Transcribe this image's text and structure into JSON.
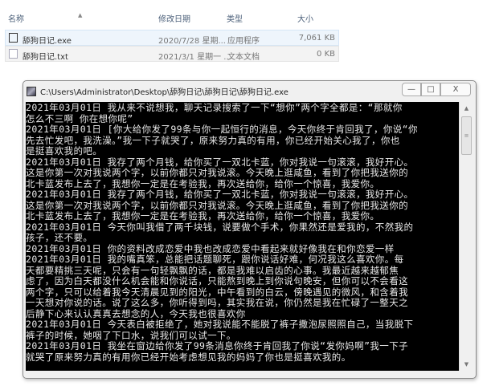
{
  "explorer": {
    "columns": {
      "name": "名称",
      "modified": "修改日期",
      "type": "类型",
      "size": "大小"
    },
    "files": [
      {
        "name": "舔狗日记.exe",
        "modified": "2020/7/28 星期...",
        "type": "应用程序",
        "size": "7,061 KB",
        "icon": "exe-icon"
      },
      {
        "name": "舔狗日记.txt",
        "modified": "2021/3/1 星期一 ...",
        "type": "文本文档",
        "size": "0 KB",
        "icon": "text-file-icon"
      }
    ]
  },
  "console_window": {
    "title": "C:\\Users\\Administrator\\Desktop\\舔狗日记\\舔狗日记\\舔狗日记.exe",
    "buttons": {
      "minimize": "—",
      "maximize": "□",
      "close": "X"
    },
    "lines": [
      "2021年03月01日 我从来不说想我，聊天记录搜索了一下“想你”两个字全都是：“那就你",
      "怎么不三啊 你在想你呢”",
      "2021年03月01日 [你大给你发了99条与你一起恒行的消息，今天你终于肯回我了，你说“你",
      "先去忙发吧，我洗澡。”我一下子就哭了，原来努力真的有用，你已经开始关心我了，你也",
      "是挺喜欢我的吧。",
      "2021年03月01日 我存了两个月钱，给你买了一双北卡蓝，你对我说一句滚滚，我好开心。",
      "这是你第一次对我说两个字，以前你都只对我说滚。今天晚上逛咸鱼，看到了你把我送你的",
      "北卡蓝发布上去了，我想你一定是在考验我，再次送给你，给你一个惊喜，我爱你。",
      "2021年03月01日 我存了两个月钱，给你买了一双北卡蓝，你对我说一句滚滚，我好开心。",
      "这是你第一次对我说两个字，以前你都只对我说滚。今天晚上逛咸鱼，看到了你把我送你的",
      "北卡蓝发布上去了，我想你一定是在考验我，再次送给你，给你一个惊喜，我爱你。",
      "2021年03月01日 今天你叫我借了两千块钱，说要做个手术，你果然还是爱我的，不然我的",
      "孩子，还不要。",
      "2021年03月01日 你的资料改成恋爱中我也改成恋爱中看起来就好像我在和你恋爱一样",
      "2021年03月01日 我的嘴真笨，总能把话题聊死，跟你说话好难，何况我这么喜欢你。每",
      "天都要精挑三天呢，只会有一句轻飘飘的话，都是我难以启齿的心事。我最近越来越郁焦",
      "虑了，因为白天都没什么机会能和你说话，只能熬到晚上到你说句晚安，但你可以不会看这",
      "两个字，只可以给着我今天清晨见到的阳光，中午看到的白云，傍晚遇见的微风，和含着我",
      "一天想对你说的话。说了这么多，你听得到吗，其实我在说，你仍然是我在忙碌了一整天之",
      "后静下心来认认真真去想念的人，今天我也很喜欢你",
      "2021年03月01日 今天表白被拒绝了，她对我说能不能脱了裤子撒泡尿照照自己，当我脱下",
      "裤子的时候，她咽了下口水，说我们可以试一下。",
      "2021年03月01日 我坐在窗边给你发了99条消息你终于肯回我了你说“发你妈啊”我一下子",
      "就哭了原来努力真的有用你已经开始考虑想见我的妈妈了你也是挺喜欢我的。"
    ]
  }
}
